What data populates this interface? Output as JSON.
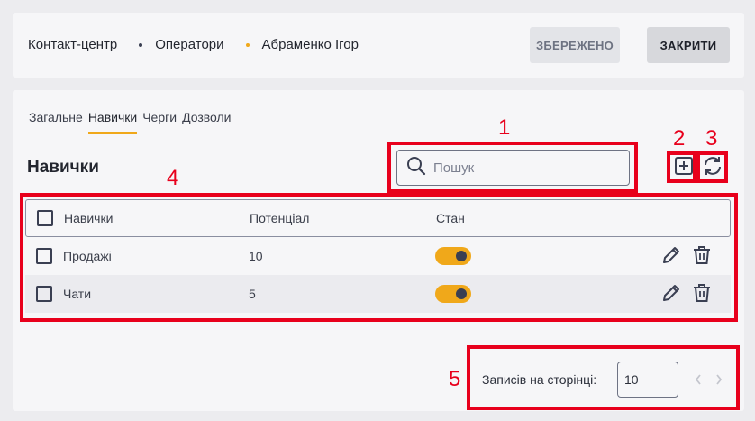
{
  "breadcrumb": [
    "Контакт-центр",
    "Оператори",
    "Абраменко Ігор"
  ],
  "header_buttons": {
    "saved": "ЗБЕРЕЖЕНО",
    "close": "ЗАКРИТИ"
  },
  "tabs": [
    "Загальне",
    "Навички",
    "Черги",
    "Дозволи"
  ],
  "active_tab": "Навички",
  "section_title": "Навички",
  "search": {
    "placeholder": "Пошук",
    "value": ""
  },
  "table": {
    "headers": [
      "Навички",
      "Потенціал",
      "Стан"
    ],
    "rows": [
      {
        "name": "Продажі",
        "potential": "10",
        "enabled": true
      },
      {
        "name": "Чати",
        "potential": "5",
        "enabled": true
      }
    ]
  },
  "pagination": {
    "label": "Записів на сторінці:",
    "per_page": "10"
  },
  "annotations": [
    "1",
    "2",
    "3",
    "4",
    "5"
  ],
  "colors": {
    "accent": "#f0a81a",
    "annotation": "#e8001c",
    "icon": "#3a3f52"
  },
  "icons": [
    "search-icon",
    "add-icon",
    "refresh-icon",
    "edit-icon",
    "trash-icon",
    "chevron-left-icon",
    "chevron-right-icon"
  ]
}
